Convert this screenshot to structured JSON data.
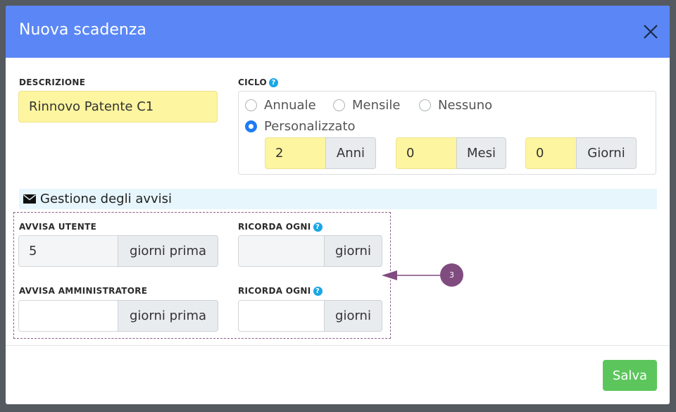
{
  "modal": {
    "title": "Nuova scadenza",
    "save_label": "Salva"
  },
  "descrizione": {
    "label": "DESCRIZIONE",
    "value": "Rinnovo Patente C1"
  },
  "ciclo": {
    "label": "CICLO",
    "help": "?",
    "options": [
      "Annuale",
      "Mensile",
      "Nessuno",
      "Personalizzato"
    ],
    "selected": "Personalizzato",
    "anni_value": "2",
    "anni_label": "Anni",
    "mesi_value": "0",
    "mesi_label": "Mesi",
    "giorni_value": "0",
    "giorni_label": "Giorni"
  },
  "avvisi": {
    "section_title": "Gestione degli avvisi",
    "utente_label": "AVVISA UTENTE",
    "utente_value": "5",
    "utente_addon": "giorni prima",
    "ricorda_label": "RICORDA OGNI",
    "ricorda_addon": "giorni",
    "admin_label": "AVVISA AMMINISTRATORE",
    "admin_value": "",
    "admin_addon": "giorni prima",
    "ricorda2_label": "RICORDA OGNI",
    "ricorda2_addon": "giorni",
    "help": "?"
  },
  "annotation": {
    "badge": "3"
  },
  "colors": {
    "header": "#5b87f6",
    "highlight": "#fdf59f",
    "save": "#5cc65c",
    "annotation": "#804c80"
  }
}
